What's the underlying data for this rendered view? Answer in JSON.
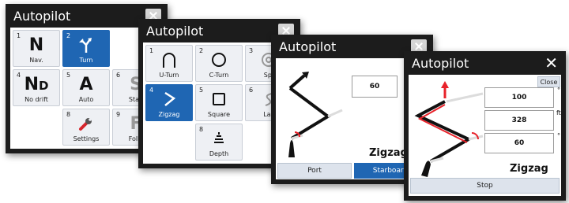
{
  "dialog1": {
    "title": "Autopilot",
    "tiles": [
      {
        "num": "1",
        "label": "Nav.",
        "icon_text": "N"
      },
      {
        "num": "2",
        "label": "Turn",
        "icon": "turn-icon",
        "selected": true
      },
      {
        "num": "4",
        "label": "No drift",
        "icon_text": "ND"
      },
      {
        "num": "5",
        "label": "Auto",
        "icon_text": "A"
      },
      {
        "num": "6",
        "label": "Stan",
        "icon": "s-icon"
      },
      {
        "num": "8",
        "label": "Settings",
        "icon": "wrench-icon"
      },
      {
        "num": "9",
        "label": "Follo",
        "icon_text": "F"
      }
    ]
  },
  "dialog2": {
    "title": "Autopilot",
    "tiles": [
      {
        "num": "1",
        "label": "U-Turn",
        "icon": "u-turn-icon"
      },
      {
        "num": "2",
        "label": "C-Turn",
        "icon": "circle-icon"
      },
      {
        "num": "3",
        "label": "Spi",
        "icon": "spiral-icon"
      },
      {
        "num": "4",
        "label": "Zigzag",
        "icon": "zigzag-icon",
        "selected": true
      },
      {
        "num": "5",
        "label": "Square",
        "icon": "square-icon"
      },
      {
        "num": "6",
        "label": "Laz",
        "icon": "lazy-s-icon"
      },
      {
        "num": "8",
        "label": "Depth",
        "icon": "depth-icon"
      }
    ]
  },
  "dialog3": {
    "title": "Autopilot",
    "value": "60",
    "pattern": "Zigzag",
    "port_label": "Port",
    "starboard_label": "Starboard"
  },
  "dialog4": {
    "title": "Autopilot",
    "close_label": "Close",
    "values": [
      "100",
      "328",
      "60"
    ],
    "units": [
      "°",
      "ft",
      "°"
    ],
    "pattern": "Zigzag",
    "stop_label": "Stop"
  },
  "colors": {
    "accent": "#1f66b3",
    "titlebar": "#1c1c1c",
    "route_red": "#e8222a"
  }
}
